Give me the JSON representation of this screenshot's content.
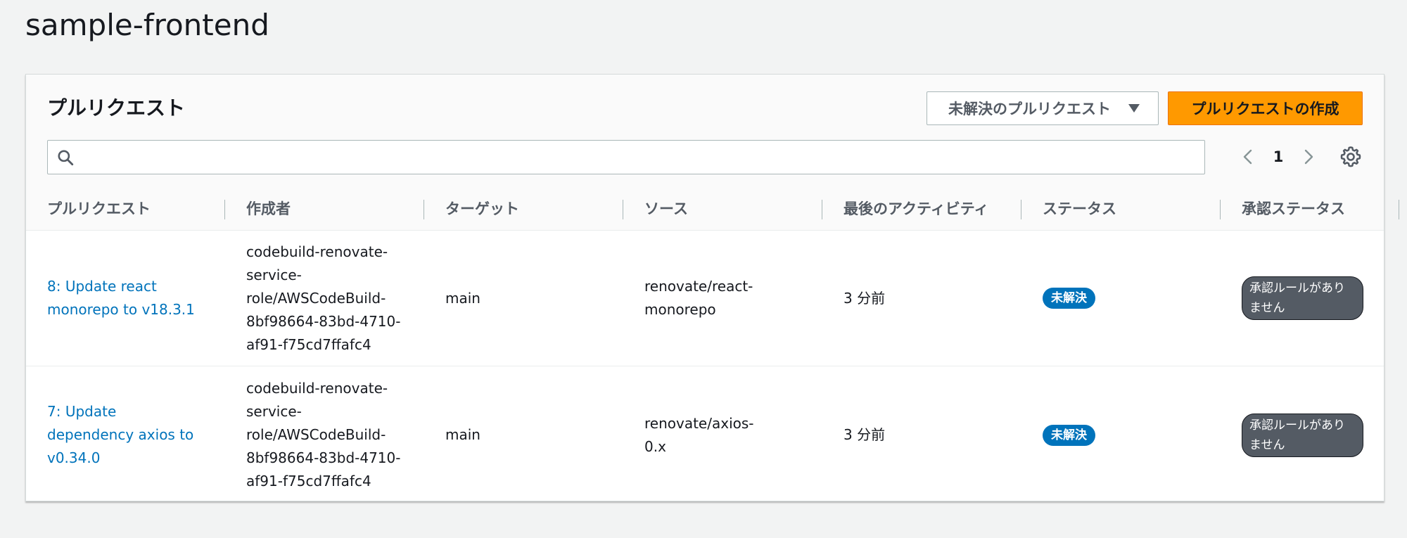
{
  "page": {
    "title": "sample-frontend"
  },
  "panel": {
    "title": "プルリクエスト",
    "filter_label": "未解決のプルリクエスト",
    "create_label": "プルリクエストの作成",
    "search": {
      "value": "",
      "placeholder": ""
    },
    "pager": {
      "current_page": "1"
    }
  },
  "table": {
    "columns": [
      "プルリクエスト",
      "作成者",
      "ターゲット",
      "ソース",
      "最後のアクティビティ",
      "ステータス",
      "承認ステータス"
    ],
    "rows": [
      {
        "title": "8: Update react monorepo to v18.3.1",
        "author": "codebuild-renovate-service-role/AWSCodeBuild-8bf98664-83bd-4710-af91-f75cd7ffafc4",
        "target": "main",
        "source": "renovate/react-monorepo",
        "last_activity": "3 分前",
        "status": "未解決",
        "approval_status": "承認ルールがありません"
      },
      {
        "title": "7: Update dependency axios to v0.34.0",
        "author": "codebuild-renovate-service-role/AWSCodeBuild-8bf98664-83bd-4710-af91-f75cd7ffafc4",
        "target": "main",
        "source": "renovate/axios-0.x",
        "last_activity": "3 分前",
        "status": "未解決",
        "approval_status": "承認ルールがありません"
      }
    ]
  },
  "colors": {
    "accent_orange": "#ff9900",
    "link_blue": "#0073bb",
    "status_blue": "#0073bb",
    "approval_gray": "#545b64"
  },
  "icons": {
    "search": "search-icon",
    "prev": "chevron-left-icon",
    "next": "chevron-right-icon",
    "settings": "gear-icon",
    "dropdown": "caret-down-icon"
  }
}
